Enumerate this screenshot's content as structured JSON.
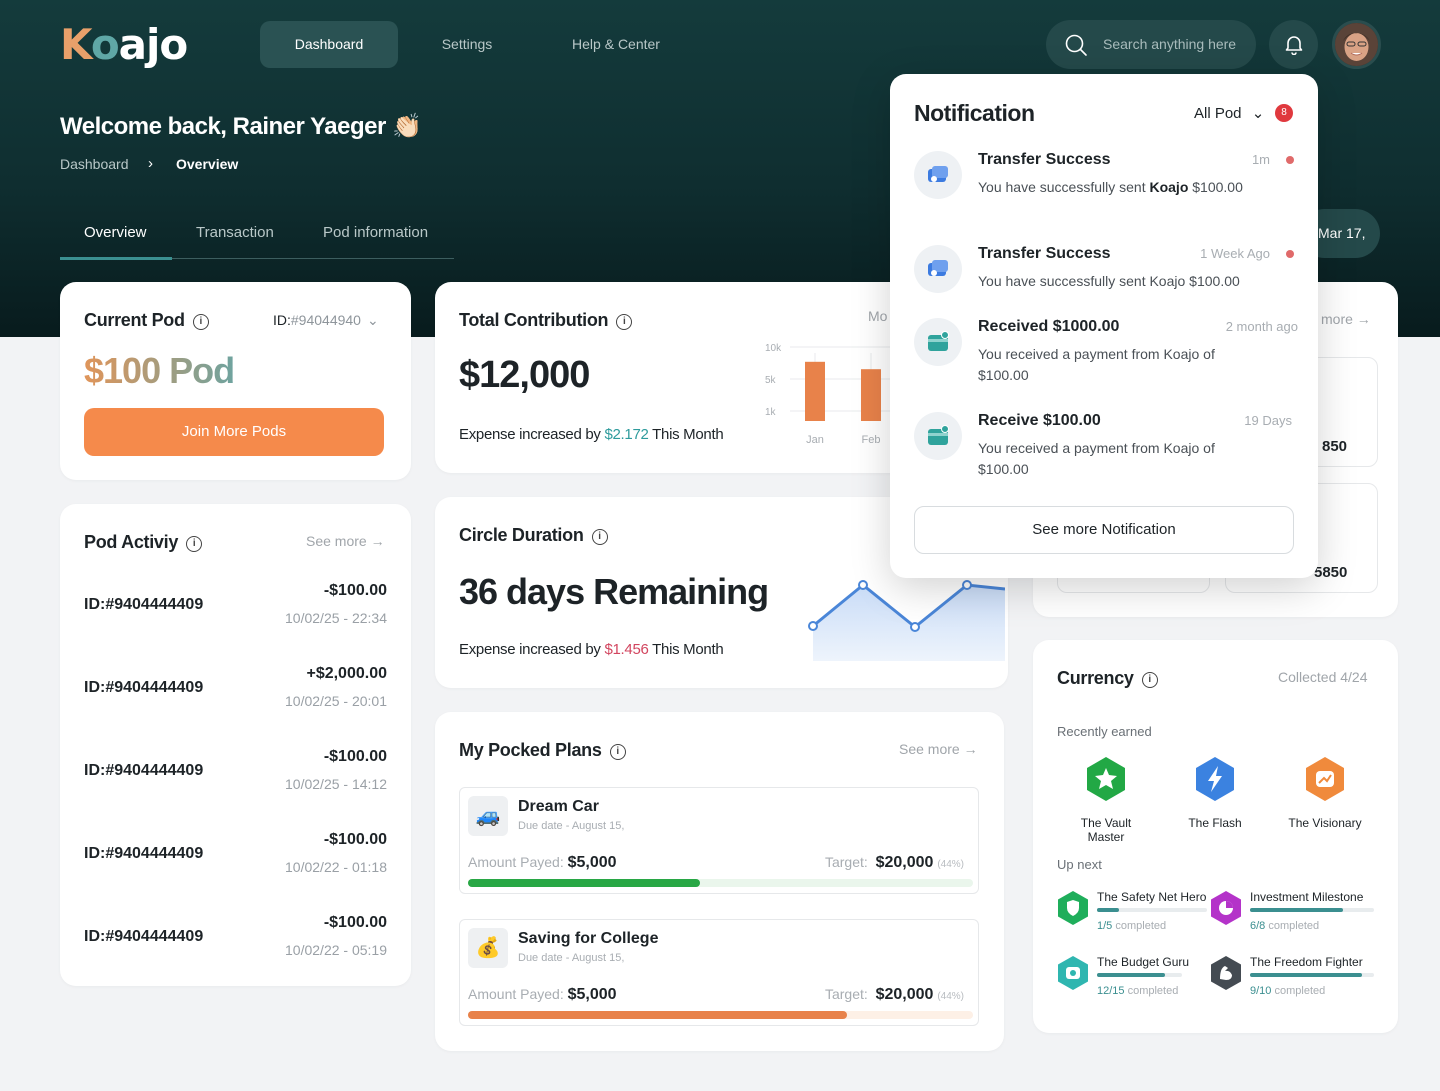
{
  "header": {
    "logo": {
      "k": "K",
      "o": "o",
      "rest": "ajo"
    },
    "nav": [
      "Dashboard",
      "Settings",
      "Help & Center"
    ],
    "search_placeholder": "Search anything here",
    "welcome": "Welcome back, Rainer Yaeger 👏🏻",
    "breadcrumb": [
      "Dashboard",
      "Overview"
    ],
    "tabs": [
      "Overview",
      "Transaction",
      "Pod information"
    ],
    "date": "Mar 17,"
  },
  "current_pod": {
    "title": "Current Pod",
    "id_label": "ID:",
    "id_value": "#94044940",
    "amount": "$100 Pod",
    "join_button": "Join More Pods"
  },
  "total_contribution": {
    "title": "Total Contribution",
    "amount": "$12,000",
    "expense_prefix": "Expense increased by",
    "expense_value": "$2.172",
    "expense_suffix": "This Month",
    "partial_label": "Mo"
  },
  "chart_data": {
    "type": "bar",
    "categories": [
      "Jan",
      "Feb"
    ],
    "values": [
      8000,
      7000
    ],
    "yticks": [
      "10k",
      "5k",
      "1k"
    ],
    "color": "#e8824a"
  },
  "circle_duration": {
    "title": "Circle Duration",
    "remaining": "36 days Remaining",
    "expense_prefix": "Expense increased by",
    "expense_value": "$1.456",
    "expense_suffix": "This Month"
  },
  "pod_activity": {
    "title": "Pod Activiy",
    "see_more": "See more",
    "rows": [
      {
        "id": "ID:#9404444409",
        "amount": "-$100.00",
        "date": "10/02/25 - 22:34"
      },
      {
        "id": "ID:#9404444409",
        "amount": "+$2,000.00",
        "date": "10/02/25 - 20:01"
      },
      {
        "id": "ID:#9404444409",
        "amount": "-$100.00",
        "date": "10/02/25 - 14:12"
      },
      {
        "id": "ID:#9404444409",
        "amount": "-$100.00",
        "date": "10/02/22 - 01:18"
      },
      {
        "id": "ID:#9404444409",
        "amount": "-$100.00",
        "date": "10/02/22 - 05:19"
      }
    ]
  },
  "plans": {
    "title": "My Pocked Plans",
    "see_more": "See more",
    "items": [
      {
        "icon": "🚙",
        "name": "Dream Car",
        "due": "Due date - August 15,",
        "paid_label": "Amount Payed:",
        "paid": "$5,000",
        "target_label": "Target:",
        "target": "$20,000",
        "pct": "(44%)",
        "progress": 0.46,
        "bar_color": "#28a745",
        "track_color": "#eaf6ec"
      },
      {
        "icon": "💰",
        "name": "Saving for College",
        "due": "Due date - August 15,",
        "paid_label": "Amount Payed:",
        "paid": "$5,000",
        "target_label": "Target:",
        "target": "$20,000",
        "pct": "(44%)",
        "progress": 0.75,
        "bar_color": "#e8824a",
        "track_color": "#fdf0e6"
      }
    ]
  },
  "side_partial": {
    "more": "more",
    "v1": "850",
    "v2": "5850"
  },
  "currency": {
    "title": "Currency",
    "collected": "Collected 4/24",
    "recent_label": "Recently earned",
    "recent": [
      {
        "name": "The Vault Master",
        "color": "#22a845",
        "icon": "star-icon"
      },
      {
        "name": "The Flash",
        "color": "#3b82e0",
        "icon": "lightning-icon"
      },
      {
        "name": "The Visionary",
        "color": "#f08a3c",
        "icon": "chart-icon"
      }
    ],
    "upnext_label": "Up next",
    "upnext": [
      {
        "name": "The Safety Net Hero",
        "done": "1/5",
        "suffix": "completed",
        "progress": 0.2,
        "color": "#1fae5b"
      },
      {
        "name": "Investment Milestone",
        "done": "6/8",
        "suffix": "completed",
        "progress": 0.75,
        "color": "#b433c9"
      },
      {
        "name": "The Budget Guru",
        "done": "12/15",
        "suffix": "completed",
        "progress": 0.8,
        "color": "#2fb6b0"
      },
      {
        "name": "The Freedom Fighter",
        "done": "9/10",
        "suffix": "completed",
        "progress": 0.9,
        "color": "#444b52"
      }
    ]
  },
  "notifications": {
    "title": "Notification",
    "filter": "All Pod",
    "count": "8",
    "see_more": "See more Notification",
    "items": [
      {
        "title": "Transfer Success",
        "time": "1m",
        "unread": true,
        "body_pre": "You have successfully sent ",
        "body_bold": "Koajo",
        "body_post": " $100.00",
        "icon": "transfer-icon"
      },
      {
        "title": "Transfer Success",
        "time": "1 Week Ago",
        "unread": true,
        "body_pre": "You have successfully sent Koajo $100.00",
        "body_bold": "",
        "body_post": "",
        "icon": "transfer-icon"
      },
      {
        "title": "Received $1000.00",
        "time": "2 month ago",
        "unread": false,
        "body_pre": "You received a payment from Koajo  of $100.00",
        "body_bold": "",
        "body_post": "",
        "icon": "wallet-icon"
      },
      {
        "title": "Receive $100.00",
        "time": "19 Days",
        "unread": false,
        "body_pre": "You received a payment from Koajo  of $100.00",
        "body_bold": "",
        "body_post": "",
        "icon": "wallet-icon"
      }
    ]
  }
}
